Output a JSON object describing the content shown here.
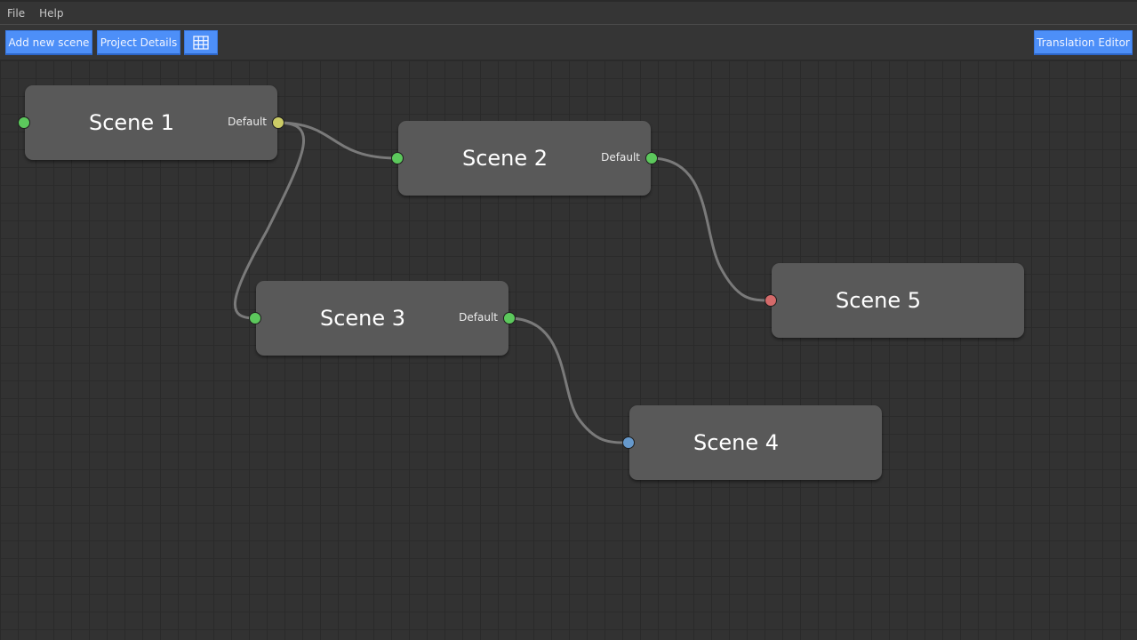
{
  "menu": {
    "items": [
      "File",
      "Help"
    ]
  },
  "toolbar": {
    "add_scene": "Add new scene",
    "project_details": "Project Details",
    "grid_toggle_icon": "grid-icon",
    "translation_editor": "Translation Editor"
  },
  "colors": {
    "accent": "#4d8ff8",
    "port_green": "#5cc85c",
    "port_yellow": "#cccc66",
    "port_red": "#d46a6a",
    "port_blue": "#6699cc",
    "wire": "#7a7a7a"
  },
  "nodes": [
    {
      "id": "scene-1",
      "title": "Scene 1",
      "output_label": "Default",
      "in_port": "green",
      "out_port": "yellow"
    },
    {
      "id": "scene-2",
      "title": "Scene 2",
      "output_label": "Default",
      "in_port": "green",
      "out_port": "green"
    },
    {
      "id": "scene-3",
      "title": "Scene 3",
      "output_label": "Default",
      "in_port": "green",
      "out_port": "green"
    },
    {
      "id": "scene-4",
      "title": "Scene 4",
      "in_port": "blue"
    },
    {
      "id": "scene-5",
      "title": "Scene 5",
      "in_port": "red"
    }
  ],
  "connections": [
    {
      "from": "Scene 1",
      "to": "Scene 2"
    },
    {
      "from": "Scene 1",
      "to": "Scene 3"
    },
    {
      "from": "Scene 2",
      "to": "Scene 5"
    },
    {
      "from": "Scene 3",
      "to": "Scene 4"
    }
  ]
}
